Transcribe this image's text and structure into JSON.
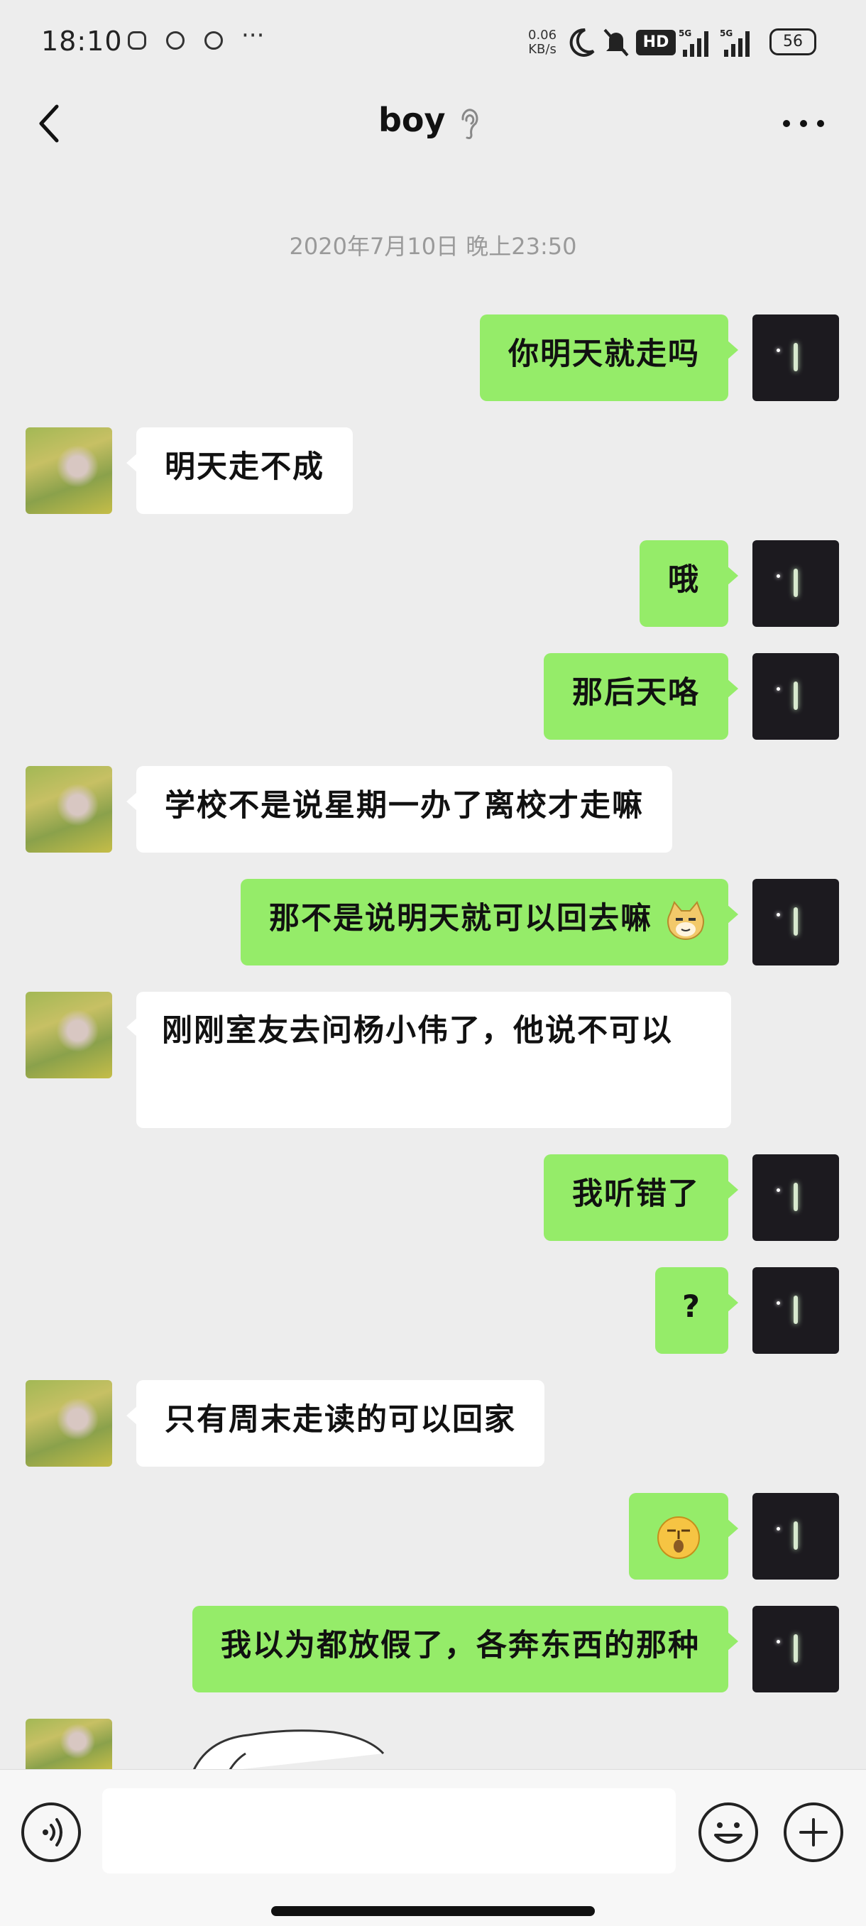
{
  "status_bar": {
    "time": "18:10",
    "more": "···",
    "net_speed": "0.06",
    "net_unit": "KB/s",
    "hd_badge": "HD",
    "signal_1": "5G",
    "signal_2": "5G",
    "battery": "56"
  },
  "header": {
    "title": "boy"
  },
  "chat": {
    "timestamp": "2020年7月10日 晚上23:50",
    "messages": [
      {
        "from": "me",
        "text": "你明天就走吗"
      },
      {
        "from": "other",
        "text": "明天走不成"
      },
      {
        "from": "me",
        "text": "哦"
      },
      {
        "from": "me",
        "text": "那后天咯"
      },
      {
        "from": "other",
        "text": "学校不是说星期一办了离校才走嘛"
      },
      {
        "from": "me",
        "text": "那不是说明天就可以回去嘛"
      },
      {
        "from": "other",
        "text": "刚刚室友去问杨小伟了，他说不可以"
      },
      {
        "from": "me",
        "text": "我听错了"
      },
      {
        "from": "me",
        "text": "?"
      },
      {
        "from": "other",
        "text": "只有周末走读的可以回家"
      },
      {
        "from": "me",
        "text": ""
      },
      {
        "from": "me",
        "text": "我以为都放假了，各奔东西的那种"
      }
    ]
  },
  "icons": {
    "back": "chevron-left-icon",
    "ear": "ear-icon",
    "more": "more-icon",
    "voice": "voice-icon",
    "emoji": "smiley-icon",
    "plus": "plus-icon"
  },
  "colors": {
    "my_bubble": "#95ec69",
    "other_bubble": "#ffffff",
    "background": "#ededed"
  }
}
